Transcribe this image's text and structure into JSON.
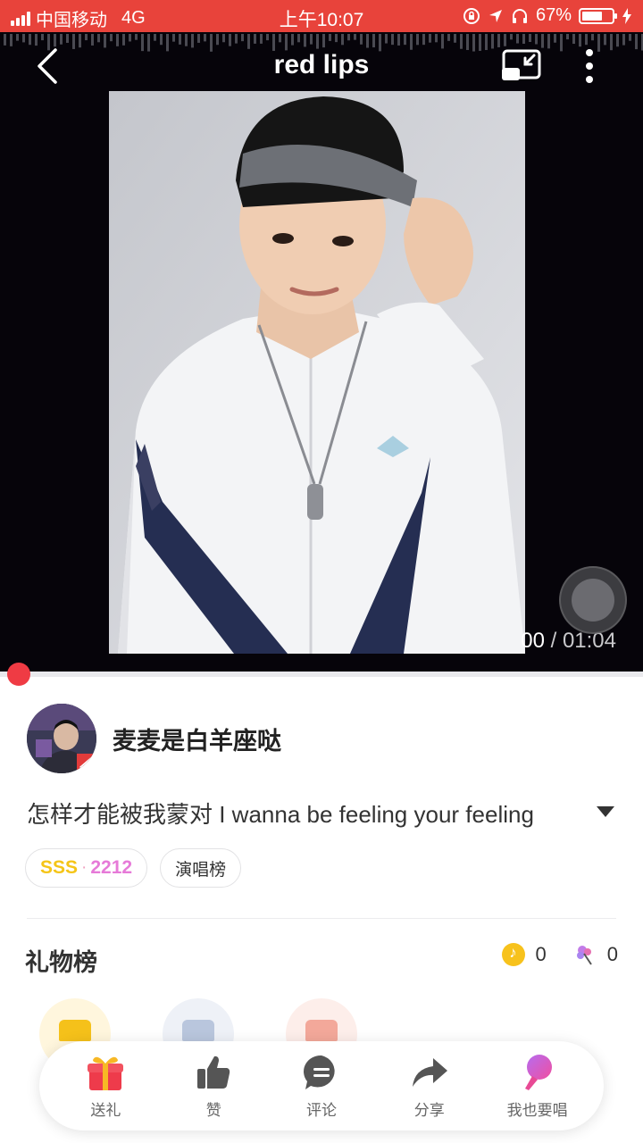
{
  "status_bar": {
    "carrier": "中国移动",
    "network": "4G",
    "time": "上午10:07",
    "battery": "67%",
    "battery_level": 0.67
  },
  "header": {
    "title": "red lips"
  },
  "player": {
    "current_time": "00",
    "separator": " / ",
    "duration": "01:04",
    "progress": 0.0
  },
  "user": {
    "name": "麦麦是白羊座哒"
  },
  "description": "怎样才能被我蒙对 I wanna be feeling your feeling",
  "tags": {
    "grade": "SSS",
    "dot": "·",
    "score": "2212",
    "ranking": "演唱榜"
  },
  "gifts": {
    "title": "礼物榜",
    "coins": "0",
    "flowers": "0"
  },
  "bottom_bar": {
    "gift": "送礼",
    "like": "赞",
    "comment": "评论",
    "share": "分享",
    "sing": "我也要唱"
  }
}
